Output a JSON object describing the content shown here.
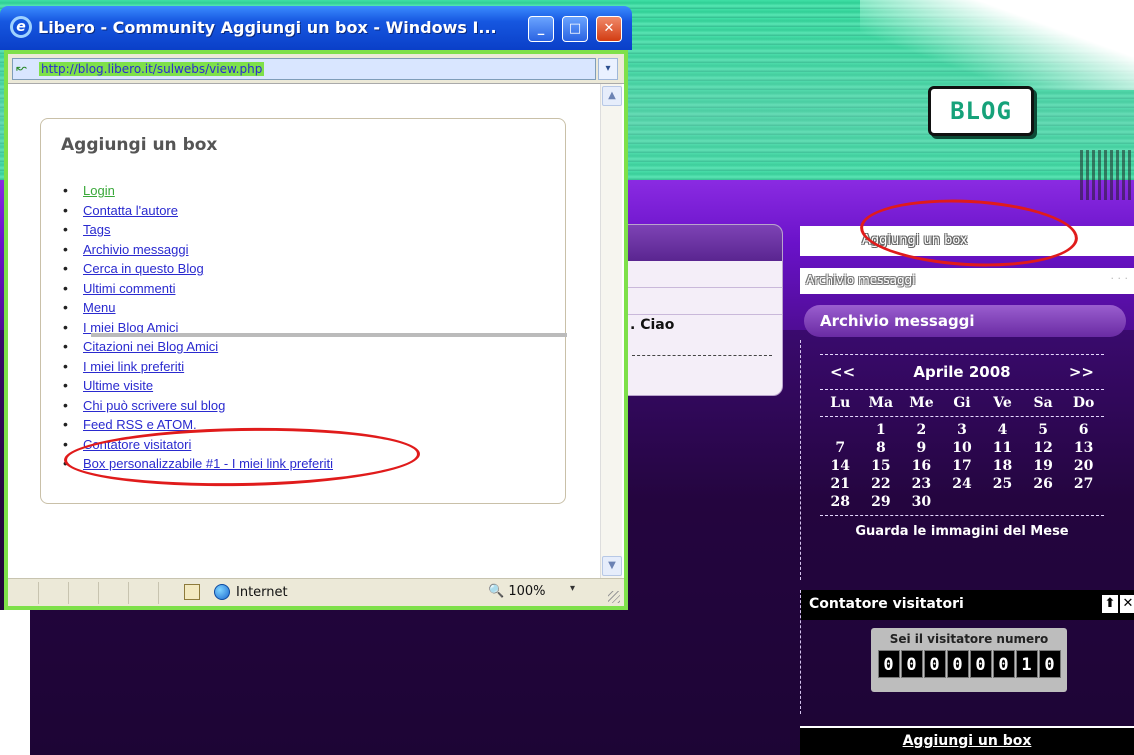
{
  "window": {
    "title": "Libero - Community Aggiungi un box - Windows I...",
    "ie_logo": "e",
    "minimize": "_",
    "maximize": "□",
    "close": "✕",
    "address": "http://blog.libero.it/sulwebs/view.php",
    "addr_dropdown": "▾"
  },
  "box_panel": {
    "title": "Aggiungi un box",
    "items": [
      "Login",
      "Contatta l'autore",
      "Tags",
      "Archivio messaggi",
      "Cerca in questo Blog",
      "Ultimi commenti",
      "Menu",
      "I miei Blog Amici",
      "Citazioni nei Blog Amici",
      "I miei link preferiti",
      "Ultime visite",
      "Chi può scrivere sul blog",
      "Feed RSS e ATOM.",
      "Contatore visitatori",
      "Box personalizzabile #1 - I miei link preferiti"
    ]
  },
  "status_bar": {
    "zone": "Internet",
    "zoom": "100%",
    "zoom_dropdown": "▾"
  },
  "blog": {
    "logo_text": "BLOG",
    "side_add_box": "Aggiungi un box",
    "side_archive_small": "Archivio messaggi",
    "content_text": ". Ciao",
    "archive_header": "Archivio messaggi",
    "calendar": {
      "prev": "<<",
      "month": "Aprile 2008",
      "next": ">>",
      "days": [
        "Lu",
        "Ma",
        "Me",
        "Gi",
        "Ve",
        "Sa",
        "Do"
      ],
      "weeks": [
        [
          "",
          "1",
          "2",
          "3",
          "4",
          "5",
          "6"
        ],
        [
          "7",
          "8",
          "9",
          "10",
          "11",
          "12",
          "13"
        ],
        [
          "14",
          "15",
          "16",
          "17",
          "18",
          "19",
          "20"
        ],
        [
          "21",
          "22",
          "23",
          "24",
          "25",
          "26",
          "27"
        ],
        [
          "28",
          "29",
          "30",
          "",
          "",
          "",
          ""
        ]
      ],
      "footer": "Guarda le immagini del Mese"
    },
    "counter": {
      "title": "Contatore visitatori",
      "up_icon": "⬆",
      "close_icon": "✕",
      "label": "Sei il visitatore numero",
      "digits": [
        "0",
        "0",
        "0",
        "0",
        "0",
        "0",
        "1",
        "0"
      ]
    },
    "bottom_add_box": "Aggiungi un box"
  },
  "colors": {
    "annotation_red": "#e01b1b",
    "link_blue": "#2a2acf",
    "xp_blue": "#1657e0",
    "frame_green": "#7ee04a"
  }
}
